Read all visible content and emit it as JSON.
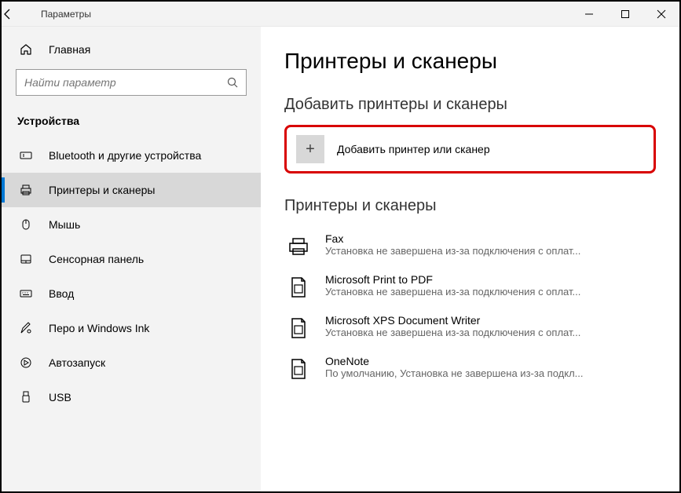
{
  "titlebar": {
    "title": "Параметры"
  },
  "home": {
    "label": "Главная"
  },
  "search": {
    "placeholder": "Найти параметр"
  },
  "section": {
    "title": "Устройства"
  },
  "nav": {
    "items": [
      {
        "label": "Bluetooth и другие устройства"
      },
      {
        "label": "Принтеры и сканеры"
      },
      {
        "label": "Мышь"
      },
      {
        "label": "Сенсорная панель"
      },
      {
        "label": "Ввод"
      },
      {
        "label": "Перо и Windows Ink"
      },
      {
        "label": "Автозапуск"
      },
      {
        "label": "USB"
      }
    ]
  },
  "main": {
    "heading": "Принтеры и сканеры",
    "add_section": "Добавить принтеры и сканеры",
    "add_label": "Добавить принтер или сканер",
    "list_section": "Принтеры и сканеры",
    "devices": [
      {
        "name": "Fax",
        "status": "Установка не завершена из-за подключения с оплат..."
      },
      {
        "name": "Microsoft Print to PDF",
        "status": "Установка не завершена из-за подключения с оплат..."
      },
      {
        "name": "Microsoft XPS Document Writer",
        "status": "Установка не завершена из-за подключения с оплат..."
      },
      {
        "name": "OneNote",
        "status": "По умолчанию, Установка не завершена из-за подкл..."
      }
    ]
  }
}
